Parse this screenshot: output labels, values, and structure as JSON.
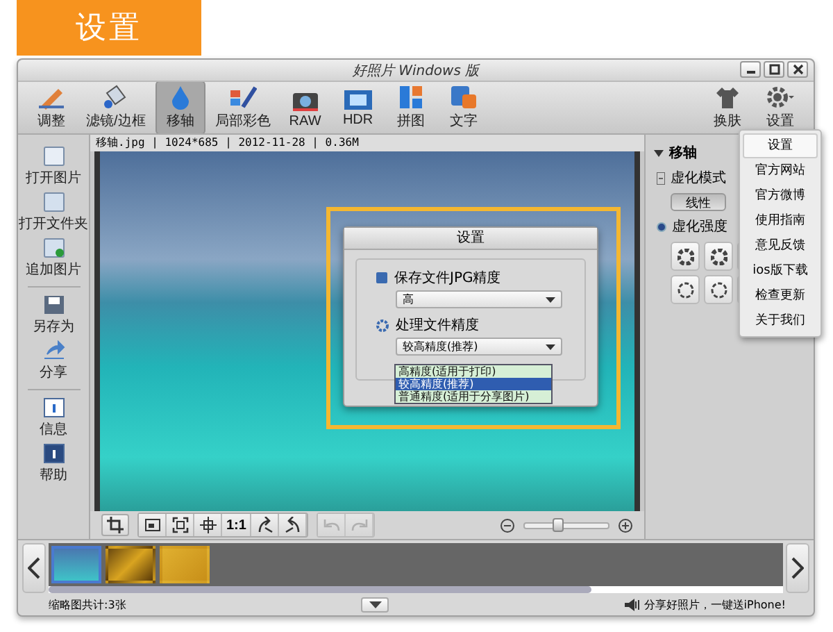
{
  "banner": {
    "title": "设置"
  },
  "window": {
    "title": "好照片 Windows 版"
  },
  "toolbar": {
    "items": [
      {
        "label": "调整",
        "selected": false
      },
      {
        "label": "滤镜/边框",
        "selected": false
      },
      {
        "label": "移轴",
        "selected": true
      },
      {
        "label": "局部彩色",
        "selected": false
      },
      {
        "label": "RAW",
        "selected": false
      },
      {
        "label": "HDR",
        "selected": false
      },
      {
        "label": "拼图",
        "selected": false
      },
      {
        "label": "文字",
        "selected": false
      }
    ],
    "right_items": [
      {
        "label": "换肤"
      },
      {
        "label": "设置"
      }
    ]
  },
  "sidebar": {
    "groups": [
      [
        {
          "label": "打开图片"
        },
        {
          "label": "打开文件夹"
        },
        {
          "label": "追加图片"
        }
      ],
      [
        {
          "label": "另存为"
        },
        {
          "label": "分享"
        }
      ],
      [
        {
          "label": "信息"
        },
        {
          "label": "帮助"
        }
      ]
    ]
  },
  "image_info": "移轴.jpg | 1024*685 | 2012-11-28 | 0.36M",
  "image_toolbar": {
    "one_to_one": "1:1",
    "zoom": {
      "level": 0.4
    }
  },
  "panel": {
    "title": "移轴",
    "expanded": true,
    "mode_label": "虚化模式",
    "mode_options": [
      {
        "label": "线性",
        "selected": true
      }
    ],
    "strength_label": "虚化强度"
  },
  "settings_menu": {
    "items": [
      {
        "label": "设置",
        "selected": true
      },
      {
        "label": "官方网站",
        "selected": false
      },
      {
        "label": "官方微博",
        "selected": false
      },
      {
        "label": "使用指南",
        "selected": false
      },
      {
        "label": "意见反馈",
        "selected": false
      },
      {
        "label": "ios版下载",
        "selected": false
      },
      {
        "label": "检查更新",
        "selected": false
      },
      {
        "label": "关于我们",
        "selected": false
      }
    ]
  },
  "dialog": {
    "title": "设置",
    "jpg_label": "保存文件JPG精度",
    "jpg_value": "高",
    "process_label": "处理文件精度",
    "process_value": "较高精度(推荐)",
    "process_options": [
      {
        "label": "高精度(适用于打印)",
        "selected": false
      },
      {
        "label": "较高精度(推荐)",
        "selected": true
      },
      {
        "label": "普通精度(适用于分享图片)",
        "selected": false
      }
    ]
  },
  "filmstrip": {
    "thumbnails": [
      {
        "selected": true
      },
      {
        "selected": false
      },
      {
        "selected": false
      }
    ]
  },
  "status_bar": {
    "count": "缩略图共计:3张",
    "promo": "分享好照片，一键送iPhone!"
  }
}
